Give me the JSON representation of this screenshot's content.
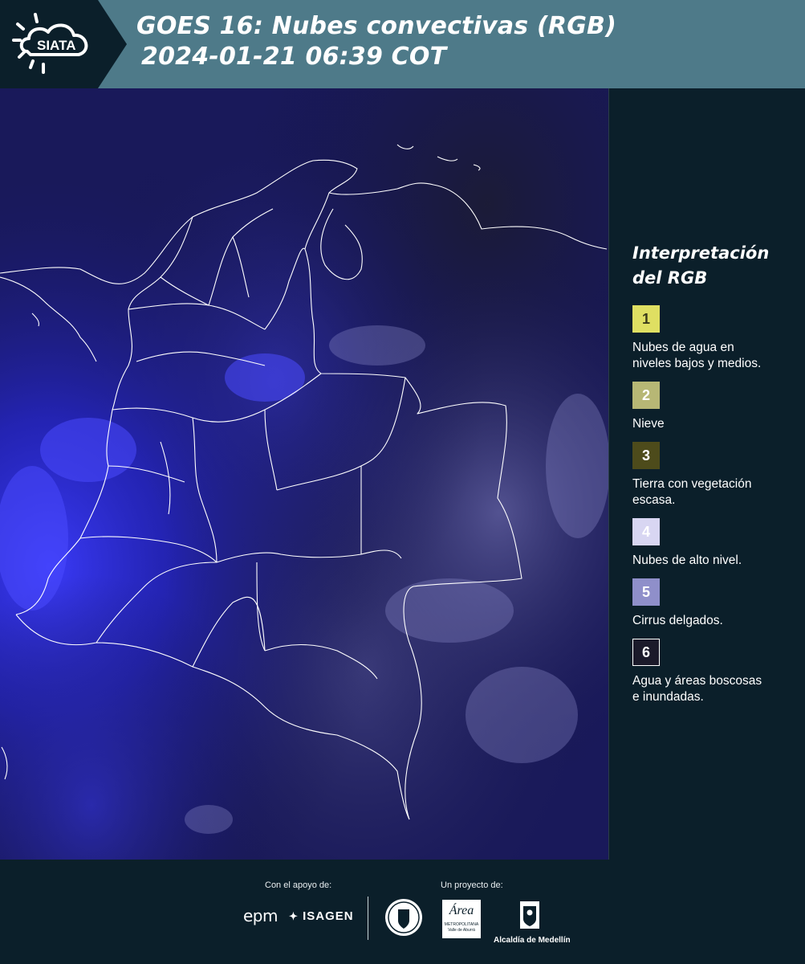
{
  "header": {
    "logo_text": "SIATA",
    "title_line1": "GOES 16: Nubes convectivas (RGB)",
    "title_line2": "2024-01-21 06:39 COT"
  },
  "legend": {
    "title_line1": "Interpretación",
    "title_line2": "del RGB",
    "items": [
      {
        "number": "1",
        "color": "#dfdf62",
        "text_color": "#3a3a1a",
        "line1": "Nubes de agua en",
        "line2": "niveles bajos y medios."
      },
      {
        "number": "2",
        "color": "#b7b775",
        "text_color": "#ffffff",
        "line1": "Nieve",
        "line2": ""
      },
      {
        "number": "3",
        "color": "#4d4b1b",
        "text_color": "#ffffff",
        "line1": "Tierra con vegetación",
        "line2": "escasa."
      },
      {
        "number": "4",
        "color": "#d8d6f2",
        "text_color": "#ffffff",
        "line1": "Nubes de alto nivel.",
        "line2": ""
      },
      {
        "number": "5",
        "color": "#8f8fca",
        "text_color": "#ffffff",
        "line1": "Cirrus delgados.",
        "line2": ""
      },
      {
        "number": "6",
        "color": "#1b1a2a",
        "text_color": "#ffffff",
        "line1": "Agua y áreas boscosas",
        "line2": "e inundadas."
      }
    ]
  },
  "footer": {
    "support_label": "Con el apoyo de:",
    "project_label": "Un proyecto de:",
    "sponsor_1": "epm",
    "sponsor_2": "ISAGEN",
    "area_text_1": "Área",
    "area_text_2": "METROPOLITANA",
    "area_text_3": "Valle de Aburrá",
    "alcaldia": "Alcaldía de Medellín"
  },
  "colors": {
    "header_bar": "#4e7a89",
    "background": "#0b1f2a",
    "map_base": "#15154a",
    "border_lines": "#ffffff"
  }
}
